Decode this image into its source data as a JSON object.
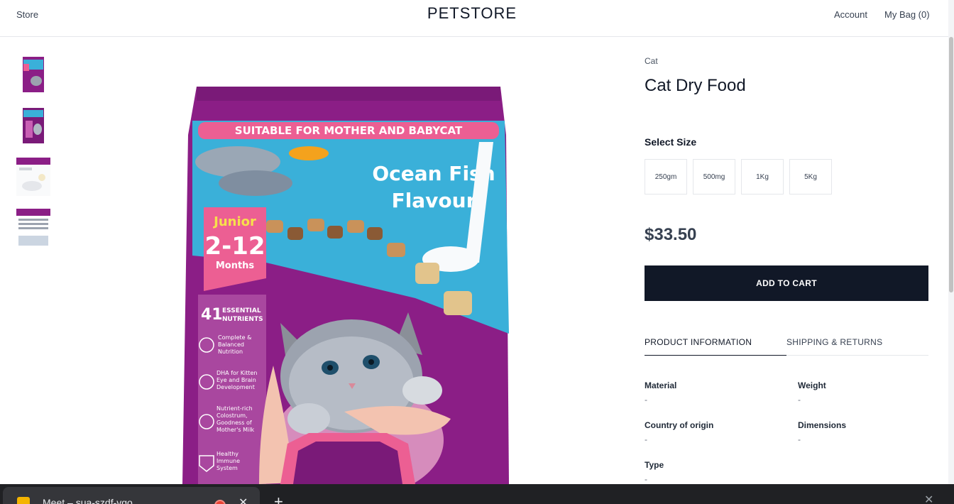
{
  "header": {
    "store_label": "Store",
    "brand": "PETSTORE",
    "account_label": "Account",
    "bag_label": "My Bag (0)"
  },
  "product": {
    "category": "Cat",
    "title": "Cat Dry Food",
    "select_size_label": "Select Size",
    "sizes": [
      "250gm",
      "500mg",
      "1Kg",
      "5Kg"
    ],
    "price": "$33.50",
    "add_to_cart_label": "ADD TO CART",
    "tabs": [
      "PRODUCT INFORMATION",
      "SHIPPING & RETURNS"
    ],
    "specs": [
      {
        "label": "Material",
        "value": "-"
      },
      {
        "label": "Weight",
        "value": "-"
      },
      {
        "label": "Country of origin",
        "value": "-"
      },
      {
        "label": "Dimensions",
        "value": "-"
      },
      {
        "label": "Type",
        "value": "-"
      }
    ]
  },
  "package_art": {
    "banner": "SUITABLE FOR MOTHER AND BABYCAT",
    "flavour_line1": "Ocean Fish",
    "flavour_line2": "Flavour",
    "age_top": "Junior",
    "age_range": "2-12",
    "age_unit": "Months",
    "nutrients_count": "41",
    "nutrients_label1": "ESSENTIAL",
    "nutrients_label2": "NUTRIENTS",
    "benefit1": [
      "Complete &",
      "Balanced",
      "Nutrition"
    ],
    "benefit2": [
      "DHA for Kitten",
      "Eye and Brain",
      "Development"
    ],
    "benefit3": [
      "Nutrient-rich",
      "Colostrum,",
      "Goodness of",
      "Mother's Milk"
    ],
    "benefit4": [
      "Healthy",
      "Immune",
      "System"
    ],
    "colors": {
      "purple": "#8b1e86",
      "pink": "#ec5f93",
      "sky": "#3ab0d9"
    }
  },
  "taskbar": {
    "tab_label": "Meet – sua-szdf-vgo",
    "icons": [
      "meet-icon",
      "record-icon",
      "close-icon",
      "plus-icon"
    ]
  }
}
